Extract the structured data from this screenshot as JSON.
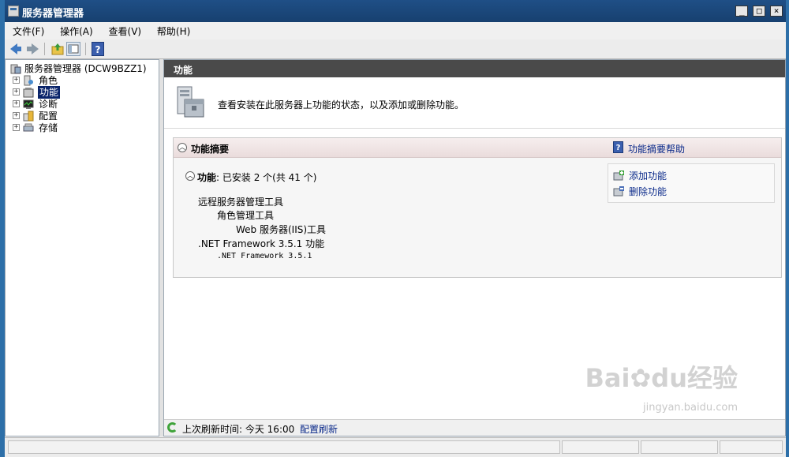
{
  "window": {
    "title": "服务器管理器",
    "controls": [
      "_",
      "□",
      "×"
    ]
  },
  "menu": [
    "文件(F)",
    "操作(A)",
    "查看(V)",
    "帮助(H)"
  ],
  "tree": {
    "root": "服务器管理器 (DCW9BZZ1)",
    "items": [
      {
        "label": "角色",
        "expander": "+",
        "icon": "roles-icon"
      },
      {
        "label": "功能",
        "expander": "+",
        "icon": "features-icon",
        "selected": true
      },
      {
        "label": "诊断",
        "expander": "+",
        "icon": "diagnostics-icon"
      },
      {
        "label": "配置",
        "expander": "+",
        "icon": "configuration-icon"
      },
      {
        "label": "存储",
        "expander": "+",
        "icon": "storage-icon"
      }
    ]
  },
  "content": {
    "header": "功能",
    "intro": "查看安装在此服务器上功能的状态，以及添加或删除功能。",
    "summary": {
      "title": "功能摘要",
      "help_link": "功能摘要帮助",
      "status_label": "功能",
      "status_value": ": 已安装 2 个(共 41 个)",
      "features": [
        {
          "text": "远程服务器管理工具"
        },
        {
          "text": "角色管理工具"
        },
        {
          "text": "Web 服务器(IIS)工具"
        },
        {
          "text": ".NET Framework 3.5.1 功能"
        },
        {
          "text": ".NET Framework 3.5.1"
        }
      ],
      "actions": [
        {
          "label": "添加功能",
          "icon": "add-feature-icon"
        },
        {
          "label": "删除功能",
          "icon": "remove-feature-icon"
        }
      ]
    },
    "footer": {
      "refresh_text": "上次刷新时间: 今天 16:00",
      "refresh_link": "配置刷新"
    }
  },
  "watermark": {
    "brand": "Bai",
    "brand2": "du",
    "brand_cn": "经验",
    "url": "jingyan.baidu.com"
  }
}
